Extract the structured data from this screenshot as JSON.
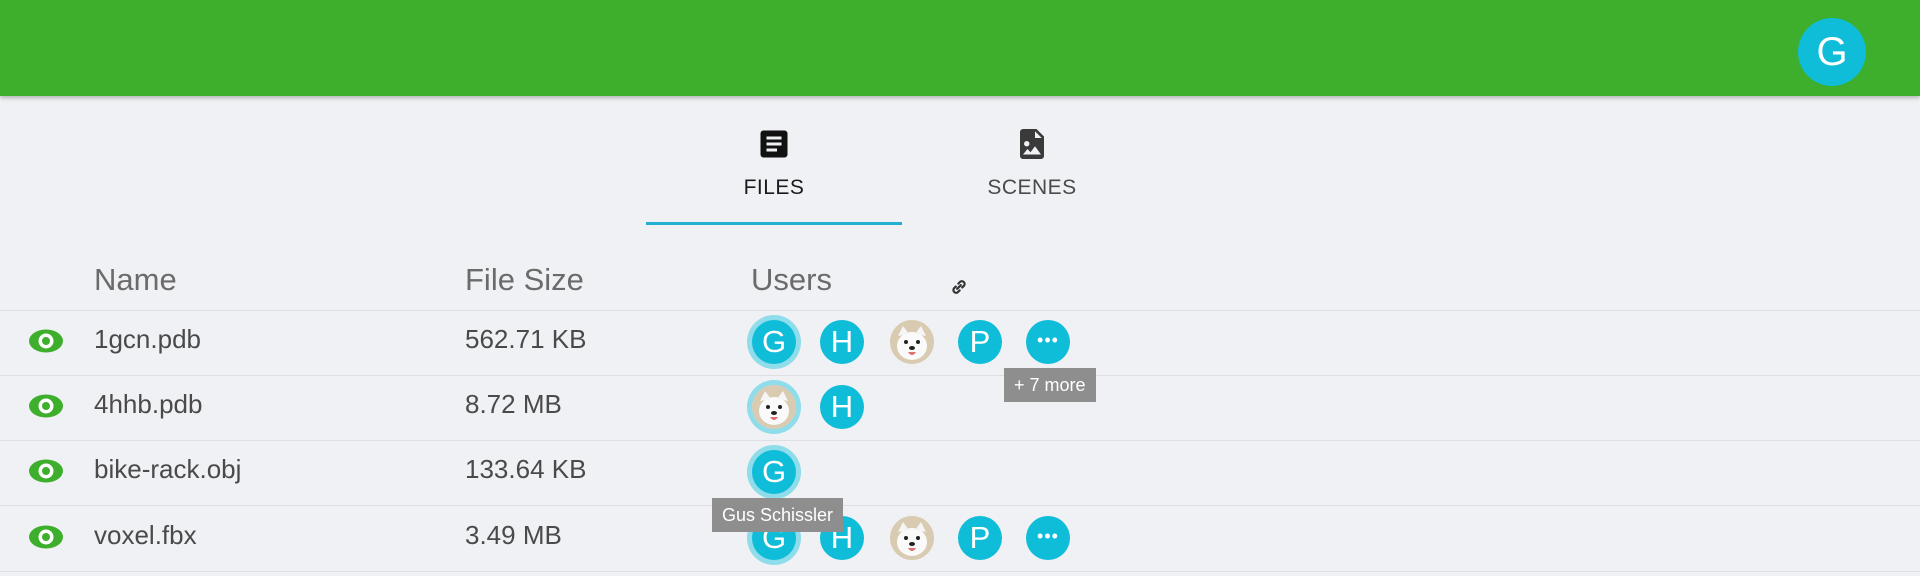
{
  "header": {
    "account_initial": "G",
    "bar_color": "#3eaf2c"
  },
  "tabs": [
    {
      "label": "FILES",
      "icon": "document-icon",
      "active": true
    },
    {
      "label": "SCENES",
      "icon": "image-file-icon",
      "active": false
    }
  ],
  "table": {
    "columns": [
      "Name",
      "File Size",
      "Users"
    ],
    "rows": [
      {
        "name": "1gcn.pdb",
        "size": "562.71 KB",
        "users": [
          "G",
          "H",
          "photo",
          "P",
          "more"
        ]
      },
      {
        "name": "4hhb.pdb",
        "size": "8.72 MB",
        "users": [
          "photo",
          "H"
        ]
      },
      {
        "name": "bike-rack.obj",
        "size": "133.64 KB",
        "users": [
          "G"
        ]
      },
      {
        "name": "voxel.fbx",
        "size": "3.49 MB",
        "users": [
          "G",
          "H",
          "photo",
          "P",
          "more"
        ]
      }
    ]
  },
  "tooltips": {
    "more_users": "+ 7 more",
    "user_name": "Gus Schissler"
  },
  "colors": {
    "accent": "#0fbdd9",
    "brand": "#3eaf2c",
    "eye": "#3eaf2c"
  }
}
